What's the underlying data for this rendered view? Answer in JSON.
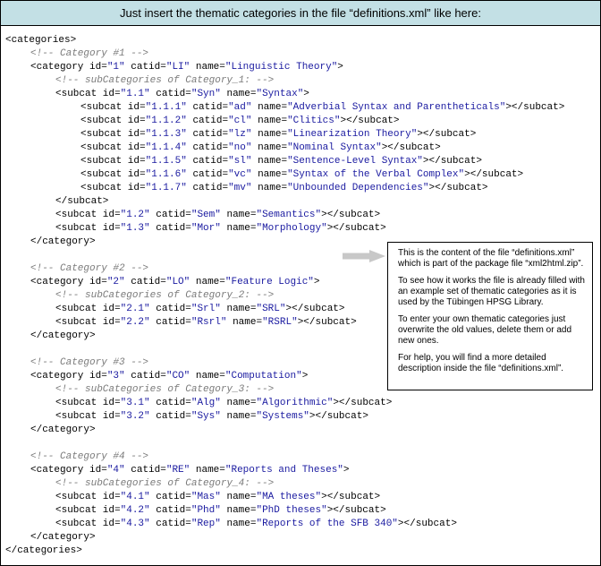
{
  "header": {
    "title": "Just insert the thematic categories in the file “definitions.xml” like here:"
  },
  "code_lines": [
    {
      "indent": 0,
      "parts": [
        {
          "t": "<categories>"
        }
      ]
    },
    {
      "indent": 1,
      "parts": [
        {
          "t": "<!-- Category #1 -->",
          "k": "c"
        }
      ]
    },
    {
      "indent": 1,
      "parts": [
        {
          "t": "<category id="
        },
        {
          "t": "\"1\"",
          "k": "v"
        },
        {
          "t": " catid="
        },
        {
          "t": "\"LI\"",
          "k": "v"
        },
        {
          "t": " name="
        },
        {
          "t": "\"Linguistic Theory\"",
          "k": "v"
        },
        {
          "t": ">"
        }
      ]
    },
    {
      "indent": 2,
      "parts": [
        {
          "t": "<!-- subCategories of Category_1: -->",
          "k": "c"
        }
      ]
    },
    {
      "indent": 2,
      "parts": [
        {
          "t": "<subcat id="
        },
        {
          "t": "\"1.1\"",
          "k": "v"
        },
        {
          "t": " catid="
        },
        {
          "t": "\"Syn\"",
          "k": "v"
        },
        {
          "t": " name="
        },
        {
          "t": "\"Syntax\"",
          "k": "v"
        },
        {
          "t": ">"
        }
      ]
    },
    {
      "indent": 3,
      "parts": [
        {
          "t": "<subcat id="
        },
        {
          "t": "\"1.1.1\"",
          "k": "v"
        },
        {
          "t": " catid="
        },
        {
          "t": "\"ad\"",
          "k": "v"
        },
        {
          "t": " name="
        },
        {
          "t": "\"Adverbial Syntax and Parentheticals\"",
          "k": "v"
        },
        {
          "t": "></subcat>"
        }
      ]
    },
    {
      "indent": 3,
      "parts": [
        {
          "t": "<subcat id="
        },
        {
          "t": "\"1.1.2\"",
          "k": "v"
        },
        {
          "t": " catid="
        },
        {
          "t": "\"cl\"",
          "k": "v"
        },
        {
          "t": " name="
        },
        {
          "t": "\"Clitics\"",
          "k": "v"
        },
        {
          "t": "></subcat>"
        }
      ]
    },
    {
      "indent": 3,
      "parts": [
        {
          "t": "<subcat id="
        },
        {
          "t": "\"1.1.3\"",
          "k": "v"
        },
        {
          "t": " catid="
        },
        {
          "t": "\"lz\"",
          "k": "v"
        },
        {
          "t": " name="
        },
        {
          "t": "\"Linearization Theory\"",
          "k": "v"
        },
        {
          "t": "></subcat>"
        }
      ]
    },
    {
      "indent": 3,
      "parts": [
        {
          "t": "<subcat id="
        },
        {
          "t": "\"1.1.4\"",
          "k": "v"
        },
        {
          "t": " catid="
        },
        {
          "t": "\"no\"",
          "k": "v"
        },
        {
          "t": " name="
        },
        {
          "t": "\"Nominal Syntax\"",
          "k": "v"
        },
        {
          "t": "></subcat>"
        }
      ]
    },
    {
      "indent": 3,
      "parts": [
        {
          "t": "<subcat id="
        },
        {
          "t": "\"1.1.5\"",
          "k": "v"
        },
        {
          "t": " catid="
        },
        {
          "t": "\"sl\"",
          "k": "v"
        },
        {
          "t": " name="
        },
        {
          "t": "\"Sentence-Level Syntax\"",
          "k": "v"
        },
        {
          "t": "></subcat>"
        }
      ]
    },
    {
      "indent": 3,
      "parts": [
        {
          "t": "<subcat id="
        },
        {
          "t": "\"1.1.6\"",
          "k": "v"
        },
        {
          "t": " catid="
        },
        {
          "t": "\"vc\"",
          "k": "v"
        },
        {
          "t": " name="
        },
        {
          "t": "\"Syntax of the Verbal Complex\"",
          "k": "v"
        },
        {
          "t": "></subcat>"
        }
      ]
    },
    {
      "indent": 3,
      "parts": [
        {
          "t": "<subcat id="
        },
        {
          "t": "\"1.1.7\"",
          "k": "v"
        },
        {
          "t": " catid="
        },
        {
          "t": "\"mv\"",
          "k": "v"
        },
        {
          "t": " name="
        },
        {
          "t": "\"Unbounded Dependencies\"",
          "k": "v"
        },
        {
          "t": "></subcat>"
        }
      ]
    },
    {
      "indent": 2,
      "parts": [
        {
          "t": "</subcat>"
        }
      ]
    },
    {
      "indent": 2,
      "parts": [
        {
          "t": "<subcat id="
        },
        {
          "t": "\"1.2\"",
          "k": "v"
        },
        {
          "t": " catid="
        },
        {
          "t": "\"Sem\"",
          "k": "v"
        },
        {
          "t": " name="
        },
        {
          "t": "\"Semantics\"",
          "k": "v"
        },
        {
          "t": "></subcat>"
        }
      ]
    },
    {
      "indent": 2,
      "parts": [
        {
          "t": "<subcat id="
        },
        {
          "t": "\"1.3\"",
          "k": "v"
        },
        {
          "t": " catid="
        },
        {
          "t": "\"Mor\"",
          "k": "v"
        },
        {
          "t": " name="
        },
        {
          "t": "\"Morphology\"",
          "k": "v"
        },
        {
          "t": "></subcat>"
        }
      ]
    },
    {
      "indent": 1,
      "parts": [
        {
          "t": "</category>"
        }
      ]
    },
    {
      "indent": 0,
      "parts": []
    },
    {
      "indent": 1,
      "parts": [
        {
          "t": "<!-- Category #2 -->",
          "k": "c"
        }
      ]
    },
    {
      "indent": 1,
      "parts": [
        {
          "t": "<category id="
        },
        {
          "t": "\"2\"",
          "k": "v"
        },
        {
          "t": " catid="
        },
        {
          "t": "\"LO\"",
          "k": "v"
        },
        {
          "t": " name="
        },
        {
          "t": "\"Feature Logic\"",
          "k": "v"
        },
        {
          "t": ">"
        }
      ]
    },
    {
      "indent": 2,
      "parts": [
        {
          "t": "<!-- subCategories of Category_2: -->",
          "k": "c"
        }
      ]
    },
    {
      "indent": 2,
      "parts": [
        {
          "t": "<subcat id="
        },
        {
          "t": "\"2.1\"",
          "k": "v"
        },
        {
          "t": " catid="
        },
        {
          "t": "\"Srl\"",
          "k": "v"
        },
        {
          "t": " name="
        },
        {
          "t": "\"SRL\"",
          "k": "v"
        },
        {
          "t": "></subcat>"
        }
      ]
    },
    {
      "indent": 2,
      "parts": [
        {
          "t": "<subcat id="
        },
        {
          "t": "\"2.2\"",
          "k": "v"
        },
        {
          "t": " catid="
        },
        {
          "t": "\"Rsrl\"",
          "k": "v"
        },
        {
          "t": " name="
        },
        {
          "t": "\"RSRL\"",
          "k": "v"
        },
        {
          "t": "></subcat>"
        }
      ]
    },
    {
      "indent": 1,
      "parts": [
        {
          "t": "</category>"
        }
      ]
    },
    {
      "indent": 0,
      "parts": []
    },
    {
      "indent": 1,
      "parts": [
        {
          "t": "<!-- Category #3 -->",
          "k": "c"
        }
      ]
    },
    {
      "indent": 1,
      "parts": [
        {
          "t": "<category id="
        },
        {
          "t": "\"3\"",
          "k": "v"
        },
        {
          "t": " catid="
        },
        {
          "t": "\"CO\"",
          "k": "v"
        },
        {
          "t": " name="
        },
        {
          "t": "\"Computation\"",
          "k": "v"
        },
        {
          "t": ">"
        }
      ]
    },
    {
      "indent": 2,
      "parts": [
        {
          "t": "<!-- subCategories of Category_3: -->",
          "k": "c"
        }
      ]
    },
    {
      "indent": 2,
      "parts": [
        {
          "t": "<subcat id="
        },
        {
          "t": "\"3.1\"",
          "k": "v"
        },
        {
          "t": " catid="
        },
        {
          "t": "\"Alg\"",
          "k": "v"
        },
        {
          "t": " name="
        },
        {
          "t": "\"Algorithmic\"",
          "k": "v"
        },
        {
          "t": "></subcat>"
        }
      ]
    },
    {
      "indent": 2,
      "parts": [
        {
          "t": "<subcat id="
        },
        {
          "t": "\"3.2\"",
          "k": "v"
        },
        {
          "t": " catid="
        },
        {
          "t": "\"Sys\"",
          "k": "v"
        },
        {
          "t": " name="
        },
        {
          "t": "\"Systems\"",
          "k": "v"
        },
        {
          "t": "></subcat>"
        }
      ]
    },
    {
      "indent": 1,
      "parts": [
        {
          "t": "</category>"
        }
      ]
    },
    {
      "indent": 0,
      "parts": []
    },
    {
      "indent": 1,
      "parts": [
        {
          "t": "<!-- Category #4 -->",
          "k": "c"
        }
      ]
    },
    {
      "indent": 1,
      "parts": [
        {
          "t": "<category id="
        },
        {
          "t": "\"4\"",
          "k": "v"
        },
        {
          "t": " catid="
        },
        {
          "t": "\"RE\"",
          "k": "v"
        },
        {
          "t": " name="
        },
        {
          "t": "\"Reports and Theses\"",
          "k": "v"
        },
        {
          "t": ">"
        }
      ]
    },
    {
      "indent": 2,
      "parts": [
        {
          "t": "<!-- subCategories of Category_4: -->",
          "k": "c"
        }
      ]
    },
    {
      "indent": 2,
      "parts": [
        {
          "t": "<subcat id="
        },
        {
          "t": "\"4.1\"",
          "k": "v"
        },
        {
          "t": " catid="
        },
        {
          "t": "\"Mas\"",
          "k": "v"
        },
        {
          "t": " name="
        },
        {
          "t": "\"MA theses\"",
          "k": "v"
        },
        {
          "t": "></subcat>"
        }
      ]
    },
    {
      "indent": 2,
      "parts": [
        {
          "t": "<subcat id="
        },
        {
          "t": "\"4.2\"",
          "k": "v"
        },
        {
          "t": " catid="
        },
        {
          "t": "\"Phd\"",
          "k": "v"
        },
        {
          "t": " name="
        },
        {
          "t": "\"PhD theses\"",
          "k": "v"
        },
        {
          "t": "></subcat>"
        }
      ]
    },
    {
      "indent": 2,
      "parts": [
        {
          "t": "<subcat id="
        },
        {
          "t": "\"4.3\"",
          "k": "v"
        },
        {
          "t": " catid="
        },
        {
          "t": "\"Rep\"",
          "k": "v"
        },
        {
          "t": " name="
        },
        {
          "t": "\"Reports of the SFB 340\"",
          "k": "v"
        },
        {
          "t": "></subcat>"
        }
      ]
    },
    {
      "indent": 1,
      "parts": [
        {
          "t": "</category>"
        }
      ]
    },
    {
      "indent": 0,
      "parts": [
        {
          "t": "</categories>"
        }
      ]
    }
  ],
  "note": {
    "paragraphs": [
      "This is the content of the file “definitions.xml” which is part of the package file “xml2html.zip”.",
      "To see how it works the file is already filled with an example set of thematic categories as it is used by the Tübingen HPSG Library.",
      "To enter your own thematic categories just overwrite the old values, delete them or add new ones.",
      "For help, you will find a more detailed description inside the file “definitions.xml”."
    ]
  },
  "colors": {
    "header_bg": "#c3e0e5",
    "value": "#1a1aa0",
    "comment": "#7b7b7b",
    "arrow": "#c8c8c8"
  },
  "icons": {
    "pointer": "right-arrow-icon"
  }
}
